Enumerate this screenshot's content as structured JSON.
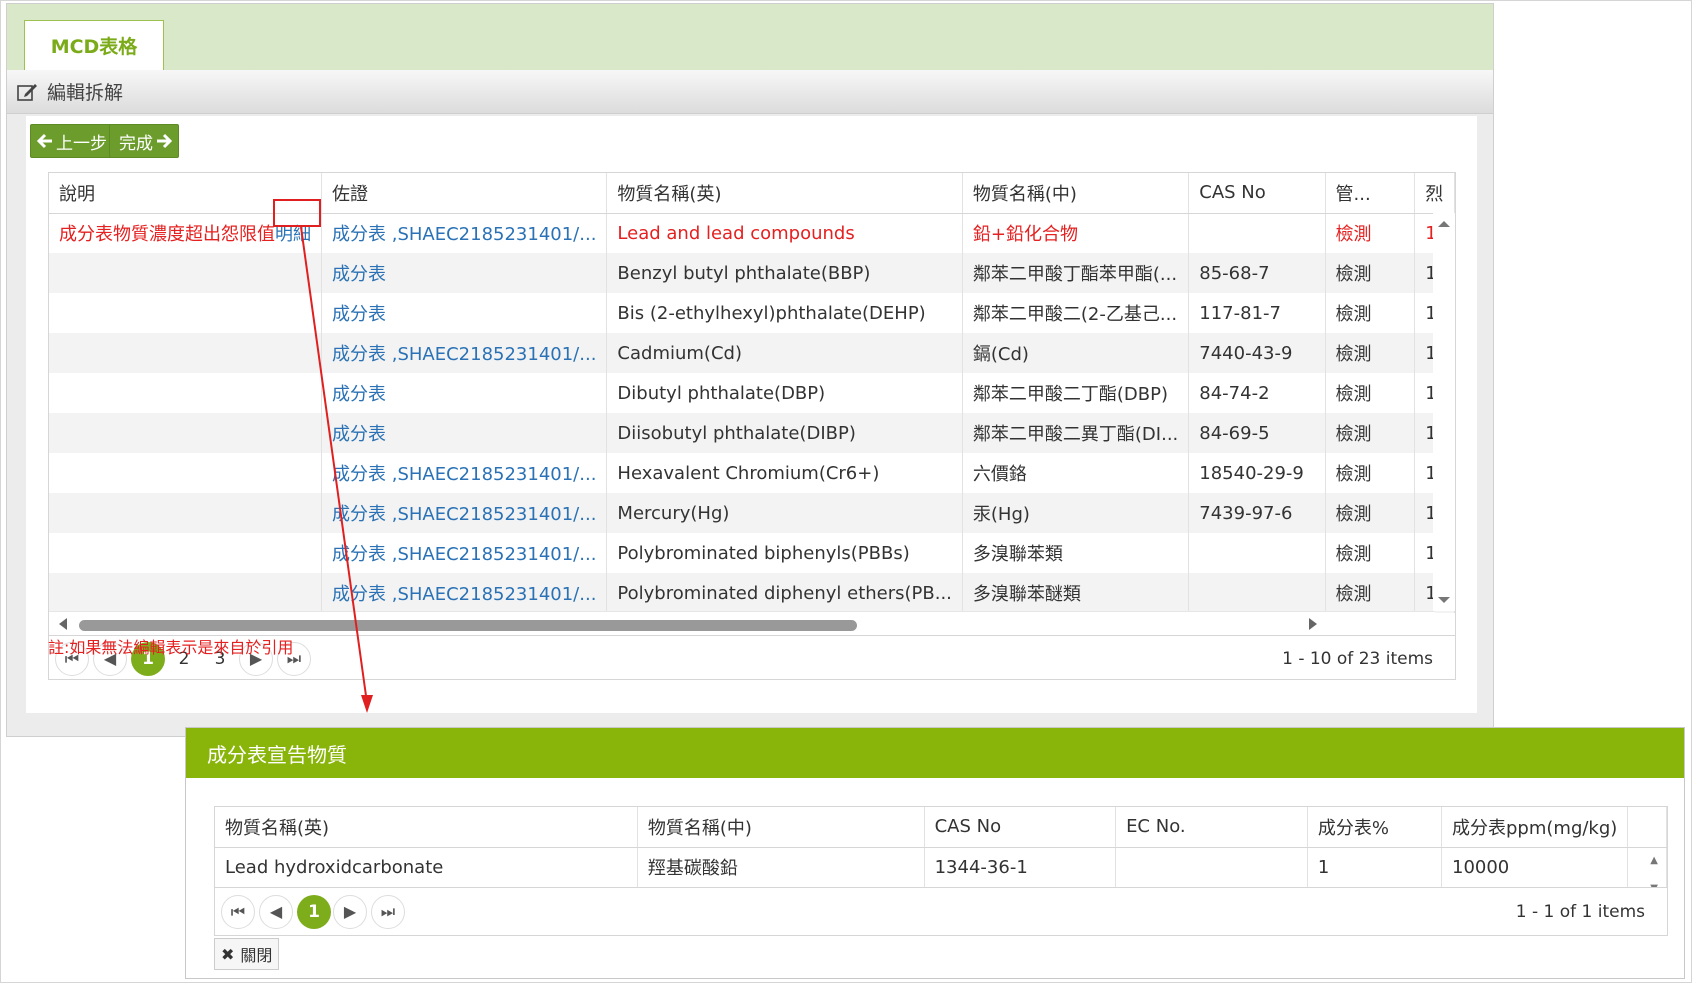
{
  "tab": {
    "label": "MCD表格"
  },
  "edit_bar": {
    "title": "編輯拆解"
  },
  "toolbar": {
    "prev_label": "上一步",
    "done_label": "完成"
  },
  "grid": {
    "columns": [
      "說明",
      "佐證",
      "物質名稱(英)",
      "物質名稱(中)",
      "CAS No",
      "管...",
      "烈"
    ],
    "rows": [
      {
        "desc": "成分表物質濃度超出怨限值",
        "detail": "明細",
        "evidence": "成分表 ,SHAEC2185231401/...",
        "name_en": "Lead and lead compounds",
        "name_zh": "鉛+鉛化合物",
        "cas": "",
        "ctrl": "檢測",
        "last": "1"
      },
      {
        "desc": "",
        "detail": "",
        "evidence": "成分表",
        "name_en": "Benzyl butyl phthalate(BBP)",
        "name_zh": "鄰苯二甲酸丁酯苯甲酯(...",
        "cas": "85-68-7",
        "ctrl": "檢測",
        "last": "1"
      },
      {
        "desc": "",
        "detail": "",
        "evidence": "成分表",
        "name_en": "Bis (2-ethylhexyl)phthalate(DEHP)",
        "name_zh": "鄰苯二甲酸二(2-乙基己...",
        "cas": "117-81-7",
        "ctrl": "檢測",
        "last": "1"
      },
      {
        "desc": "",
        "detail": "",
        "evidence": "成分表 ,SHAEC2185231401/...",
        "name_en": "Cadmium(Cd)",
        "name_zh": "鎘(Cd)",
        "cas": "7440-43-9",
        "ctrl": "檢測",
        "last": "1"
      },
      {
        "desc": "",
        "detail": "",
        "evidence": "成分表",
        "name_en": "Dibutyl phthalate(DBP)",
        "name_zh": "鄰苯二甲酸二丁酯(DBP)",
        "cas": "84-74-2",
        "ctrl": "檢測",
        "last": "1"
      },
      {
        "desc": "",
        "detail": "",
        "evidence": "成分表",
        "name_en": "Diisobutyl phthalate(DIBP)",
        "name_zh": "鄰苯二甲酸二異丁酯(DI...",
        "cas": "84-69-5",
        "ctrl": "檢測",
        "last": "1"
      },
      {
        "desc": "",
        "detail": "",
        "evidence": "成分表 ,SHAEC2185231401/...",
        "name_en": "Hexavalent Chromium(Cr6+)",
        "name_zh": "六價鉻",
        "cas": "18540-29-9",
        "ctrl": "檢測",
        "last": "1"
      },
      {
        "desc": "",
        "detail": "",
        "evidence": "成分表 ,SHAEC2185231401/...",
        "name_en": "Mercury(Hg)",
        "name_zh": "汞(Hg)",
        "cas": "7439-97-6",
        "ctrl": "檢測",
        "last": "1"
      },
      {
        "desc": "",
        "detail": "",
        "evidence": "成分表 ,SHAEC2185231401/...",
        "name_en": "Polybrominated biphenyls(PBBs)",
        "name_zh": "多溴聯苯類",
        "cas": "",
        "ctrl": "檢測",
        "last": "1"
      },
      {
        "desc": "",
        "detail": "",
        "evidence": "成分表 ,SHAEC2185231401/...",
        "name_en": "Polybrominated diphenyl ethers(PB...",
        "name_zh": "多溴聯苯醚類",
        "cas": "",
        "ctrl": "檢測",
        "last": "1"
      }
    ],
    "pages": [
      "1",
      "2",
      "3"
    ],
    "current_page": "1",
    "pager_info": "1 - 10 of 23 items"
  },
  "note": "註:如果無法編輯表示是來自於引用",
  "popup": {
    "title": "成分表宣告物質",
    "columns": [
      "物質名稱(英)",
      "物質名稱(中)",
      "CAS No",
      "EC No.",
      "成分表%",
      "成分表ppm(mg/kg)"
    ],
    "rows": [
      {
        "name_en": "Lead hydroxidcarbonate",
        "name_zh": "羥基碳酸鉛",
        "cas": "1344-36-1",
        "ec": "",
        "pct": "1",
        "ppm": "10000"
      }
    ],
    "pages": [
      "1"
    ],
    "pager_info": "1 - 1 of 1 items",
    "close_label": "關閉"
  },
  "colors": {
    "accent": "#7ead1c",
    "title_bar": "#89b50a",
    "link": "#2a72b5",
    "alert": "#e52020"
  }
}
